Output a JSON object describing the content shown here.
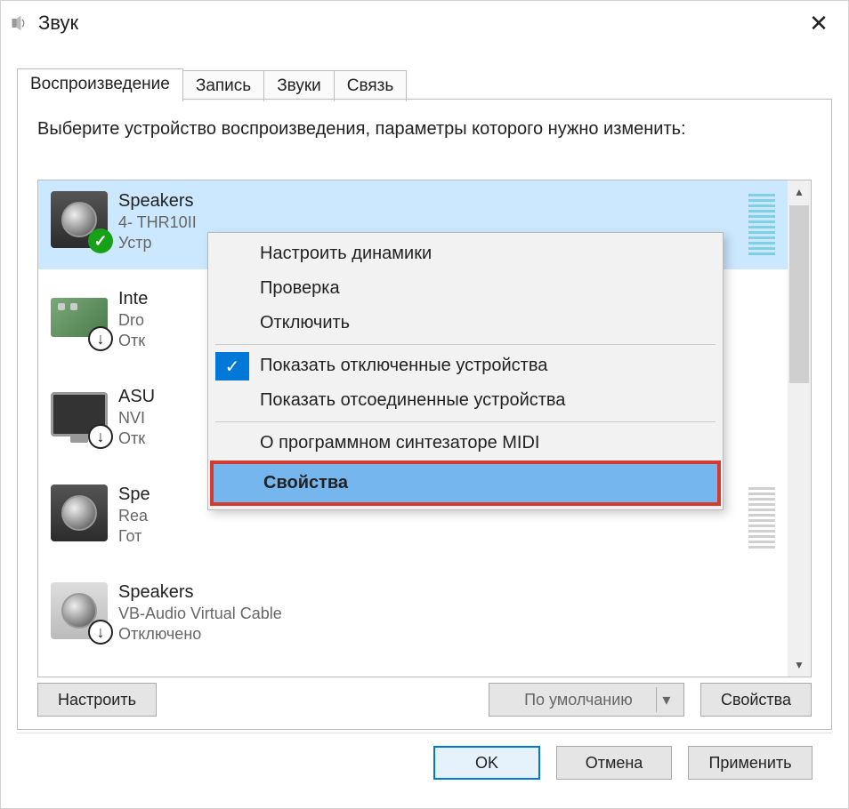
{
  "window": {
    "title": "Звук"
  },
  "tabs": {
    "playback": "Воспроизведение",
    "record": "Запись",
    "sounds": "Звуки",
    "comm": "Связь"
  },
  "instruction": "Выберите устройство воспроизведения, параметры которого нужно изменить:",
  "devices": [
    {
      "name": "Speakers",
      "sub": "4- THR10II",
      "status_partial": "Устр"
    },
    {
      "name_partial": "Inte",
      "sub_partial": "Dro",
      "status_partial": "Отк"
    },
    {
      "name_partial": "ASU",
      "sub_partial": "NVI",
      "status_partial": "Отк"
    },
    {
      "name_partial": "Spe",
      "sub_partial": "Rea",
      "status_partial": "Гот"
    },
    {
      "name": "Speakers",
      "sub": "VB-Audio Virtual Cable",
      "status": "Отключено"
    }
  ],
  "context_menu": {
    "configure": "Настроить динамики",
    "test": "Проверка",
    "disable": "Отключить",
    "show_disabled": "Показать отключенные устройства",
    "show_disconnected": "Показать отсоединенные устройства",
    "midi": "О программном синтезаторе MIDI",
    "properties": "Свойства"
  },
  "buttons": {
    "configure": "Настроить",
    "set_default": "По умолчанию",
    "properties": "Свойства",
    "ok": "OK",
    "cancel": "Отмена",
    "apply": "Применить"
  }
}
